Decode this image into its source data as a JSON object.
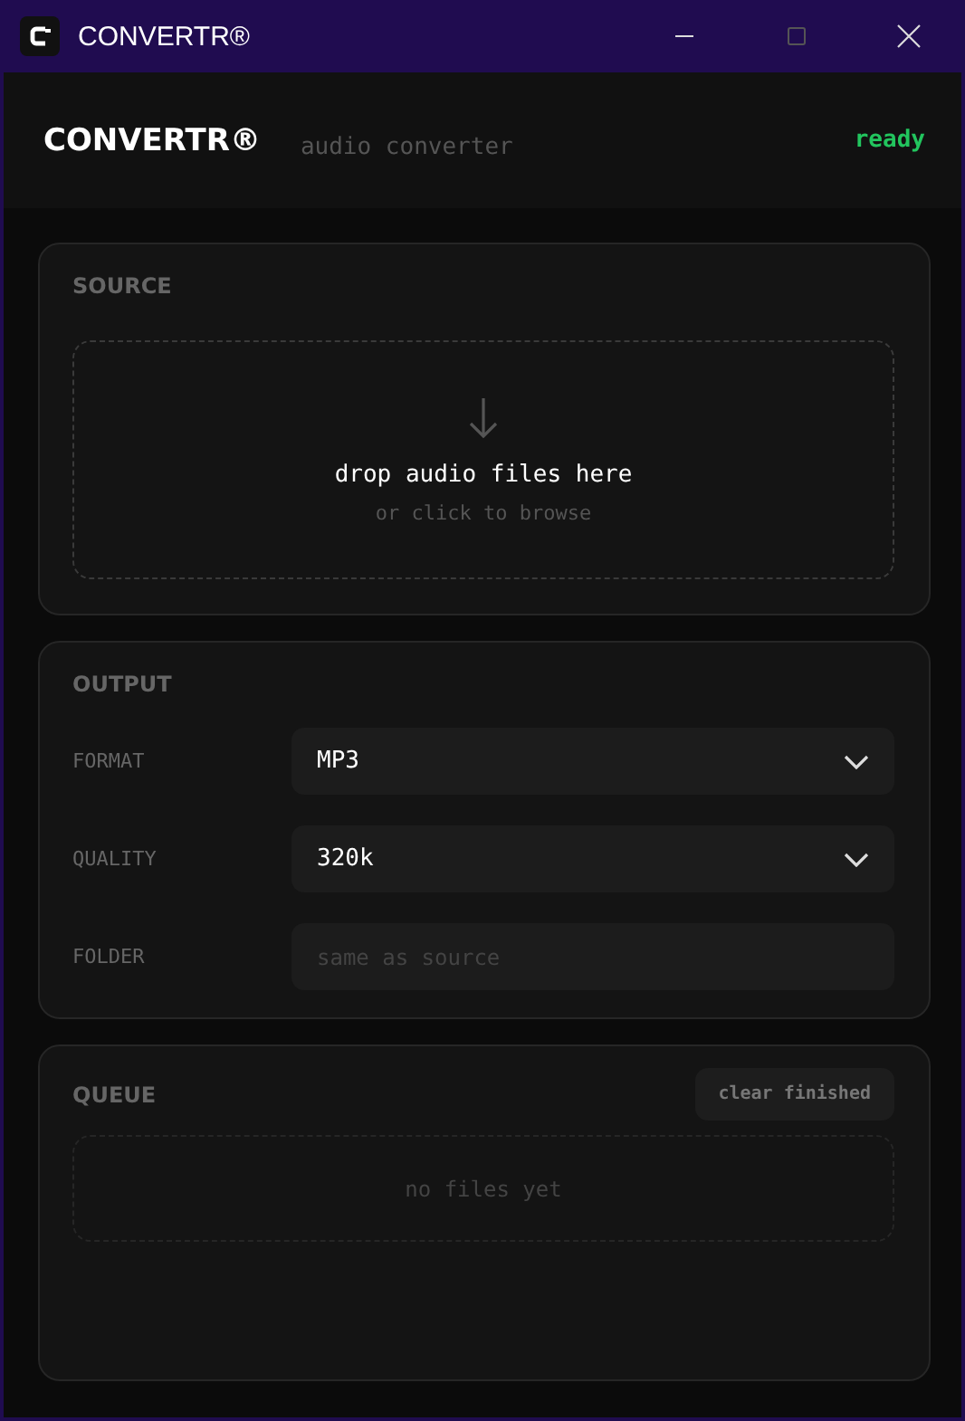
{
  "window": {
    "title": "CONVERTR®"
  },
  "header": {
    "logo": "CONVERTR®",
    "subtitle": "audio converter",
    "status": "ready"
  },
  "source": {
    "title": "SOURCE",
    "drop_text": "drop audio files here",
    "hint": "or click to browse"
  },
  "output": {
    "title": "OUTPUT",
    "fields": [
      {
        "label": "FORMAT",
        "kind": "select",
        "value": "MP3"
      },
      {
        "label": "QUALITY",
        "kind": "select",
        "value": "320k"
      },
      {
        "label": "FOLDER",
        "kind": "text",
        "placeholder": "same as source"
      }
    ]
  },
  "queue": {
    "title": "QUEUE",
    "button": "clear finished",
    "empty_text": "no files yet"
  }
}
